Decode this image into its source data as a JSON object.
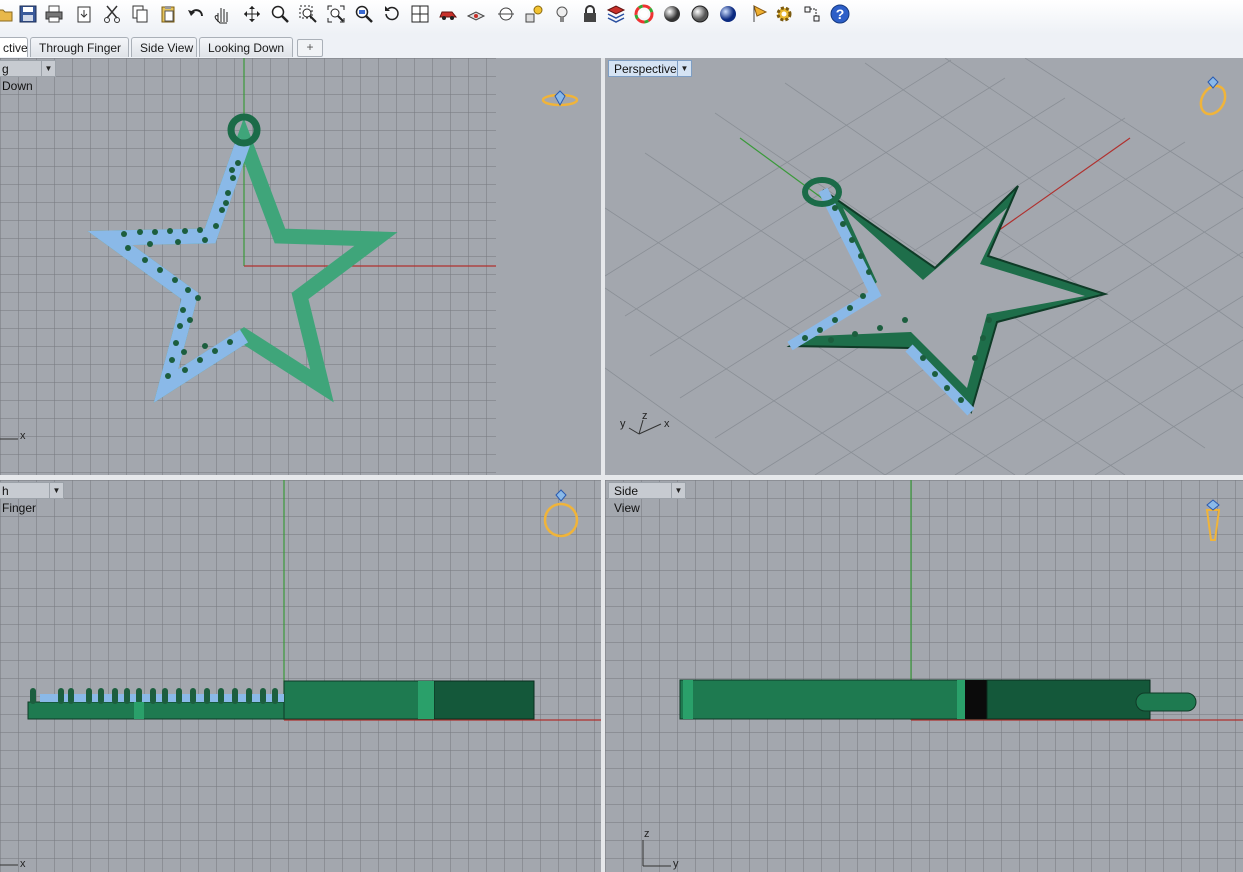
{
  "toolbar": {
    "icons": [
      "open-file-icon",
      "save-icon",
      "print-icon",
      "import-icon",
      "cut-icon",
      "copy-icon",
      "paste-icon",
      "undo-icon",
      "pan-icon",
      "move-icon",
      "zoom-icon",
      "zoom-window-icon",
      "zoom-extents-icon",
      "zoom-selected-icon",
      "rotate-view-icon",
      "four-viewports-icon",
      "car-icon",
      "eye-icon",
      "point-snap-icon",
      "lights-icon",
      "bulb-icon",
      "lock-icon",
      "layers-icon",
      "color-wheel-icon",
      "shaded-sphere-icon",
      "rendered-sphere-icon",
      "blue-sphere-icon",
      "flag-icon",
      "settings-gear-icon",
      "dimension-icon",
      "help-icon"
    ]
  },
  "tabs": [
    {
      "label": "ctive",
      "active": true
    },
    {
      "label": "Through Finger",
      "active": false
    },
    {
      "label": "Side View",
      "active": false
    },
    {
      "label": "Looking Down",
      "active": false
    }
  ],
  "tab_add_symbol": "+",
  "viewports": {
    "top_left": {
      "label": "g Down",
      "axis_x": "x"
    },
    "top_right": {
      "label": "Perspective",
      "axis_y": "y",
      "axis_z": "z",
      "axis_x": "x"
    },
    "bottom_left": {
      "label": "h Finger",
      "axis_x": "x"
    },
    "bottom_right": {
      "label": "Side View",
      "axis_z": "z",
      "axis_y": "y"
    }
  },
  "colors": {
    "star_green": "#3fa57a",
    "dark_green": "#1b6b48",
    "gem_blue": "#8ab9e8",
    "prong_green": "#1c5e3e",
    "axis_red": "#b0312f",
    "axis_green": "#3a9a3a",
    "ring_icon_gold": "#f0b43a",
    "viewport_bg": "#a3a7ae"
  }
}
